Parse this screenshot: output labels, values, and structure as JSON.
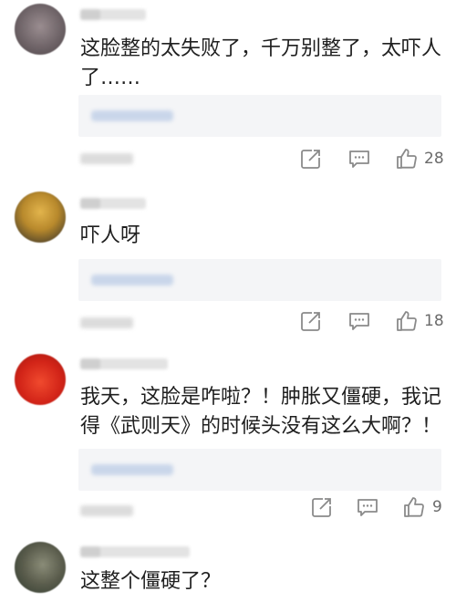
{
  "comments": [
    {
      "text": "这脸整的太失败了，千万别整了，太吓人了……",
      "likes": "28",
      "avatar_color": "#7a6e72"
    },
    {
      "text": "吓人呀",
      "likes": "18",
      "avatar_color": "#c49a3a"
    },
    {
      "text": "我天，这脸是咋啦？！肿胀又僵硬，我记得《武则天》的时候头没有这么大啊？！",
      "likes": "9",
      "avatar_color": "#d32a1e"
    },
    {
      "text": "这整个僵硬了？",
      "likes": "",
      "avatar_color": "#6d6f5d"
    }
  ],
  "icons": {
    "share": "share-icon",
    "reply": "comment-icon",
    "like": "thumbs-up-icon"
  },
  "colors": {
    "icon_gray": "#8a8a8a",
    "reply_box_bg": "#f4f5f7"
  }
}
